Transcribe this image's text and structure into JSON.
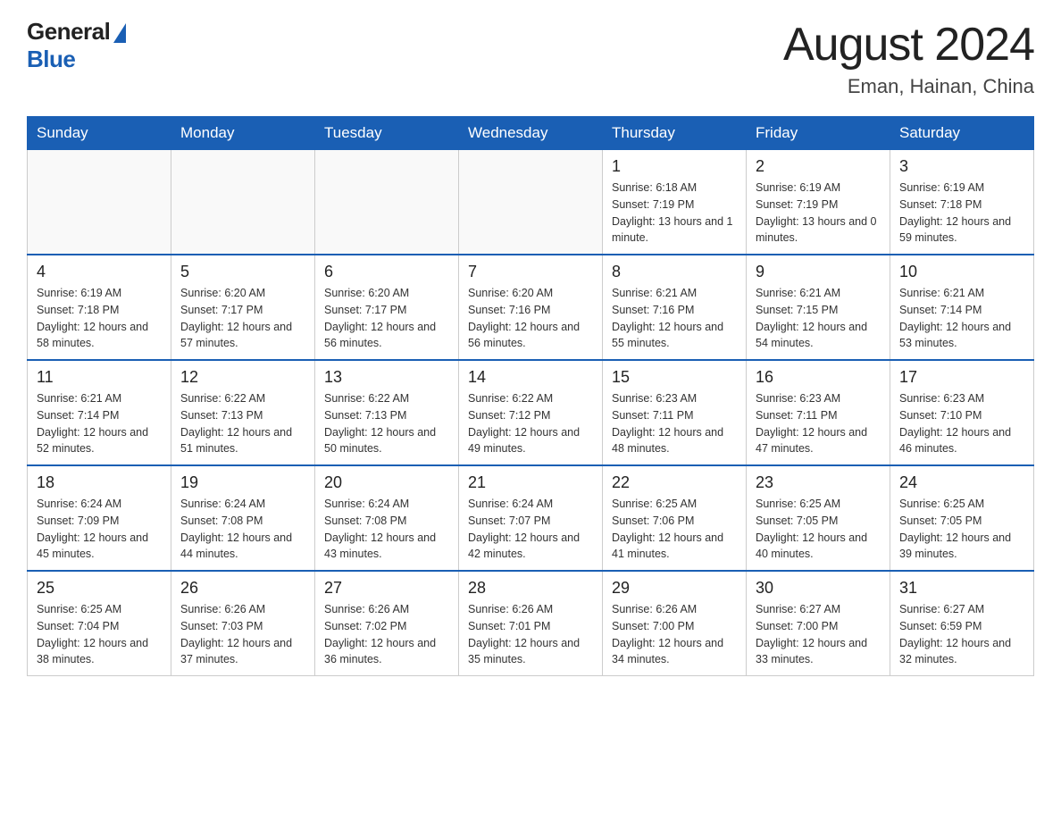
{
  "logo": {
    "general": "General",
    "blue": "Blue"
  },
  "header": {
    "month": "August 2024",
    "location": "Eman, Hainan, China"
  },
  "days_of_week": [
    "Sunday",
    "Monday",
    "Tuesday",
    "Wednesday",
    "Thursday",
    "Friday",
    "Saturday"
  ],
  "weeks": [
    [
      {
        "day": "",
        "sunrise": "",
        "sunset": "",
        "daylight": ""
      },
      {
        "day": "",
        "sunrise": "",
        "sunset": "",
        "daylight": ""
      },
      {
        "day": "",
        "sunrise": "",
        "sunset": "",
        "daylight": ""
      },
      {
        "day": "",
        "sunrise": "",
        "sunset": "",
        "daylight": ""
      },
      {
        "day": "1",
        "sunrise": "Sunrise: 6:18 AM",
        "sunset": "Sunset: 7:19 PM",
        "daylight": "Daylight: 13 hours and 1 minute."
      },
      {
        "day": "2",
        "sunrise": "Sunrise: 6:19 AM",
        "sunset": "Sunset: 7:19 PM",
        "daylight": "Daylight: 13 hours and 0 minutes."
      },
      {
        "day": "3",
        "sunrise": "Sunrise: 6:19 AM",
        "sunset": "Sunset: 7:18 PM",
        "daylight": "Daylight: 12 hours and 59 minutes."
      }
    ],
    [
      {
        "day": "4",
        "sunrise": "Sunrise: 6:19 AM",
        "sunset": "Sunset: 7:18 PM",
        "daylight": "Daylight: 12 hours and 58 minutes."
      },
      {
        "day": "5",
        "sunrise": "Sunrise: 6:20 AM",
        "sunset": "Sunset: 7:17 PM",
        "daylight": "Daylight: 12 hours and 57 minutes."
      },
      {
        "day": "6",
        "sunrise": "Sunrise: 6:20 AM",
        "sunset": "Sunset: 7:17 PM",
        "daylight": "Daylight: 12 hours and 56 minutes."
      },
      {
        "day": "7",
        "sunrise": "Sunrise: 6:20 AM",
        "sunset": "Sunset: 7:16 PM",
        "daylight": "Daylight: 12 hours and 56 minutes."
      },
      {
        "day": "8",
        "sunrise": "Sunrise: 6:21 AM",
        "sunset": "Sunset: 7:16 PM",
        "daylight": "Daylight: 12 hours and 55 minutes."
      },
      {
        "day": "9",
        "sunrise": "Sunrise: 6:21 AM",
        "sunset": "Sunset: 7:15 PM",
        "daylight": "Daylight: 12 hours and 54 minutes."
      },
      {
        "day": "10",
        "sunrise": "Sunrise: 6:21 AM",
        "sunset": "Sunset: 7:14 PM",
        "daylight": "Daylight: 12 hours and 53 minutes."
      }
    ],
    [
      {
        "day": "11",
        "sunrise": "Sunrise: 6:21 AM",
        "sunset": "Sunset: 7:14 PM",
        "daylight": "Daylight: 12 hours and 52 minutes."
      },
      {
        "day": "12",
        "sunrise": "Sunrise: 6:22 AM",
        "sunset": "Sunset: 7:13 PM",
        "daylight": "Daylight: 12 hours and 51 minutes."
      },
      {
        "day": "13",
        "sunrise": "Sunrise: 6:22 AM",
        "sunset": "Sunset: 7:13 PM",
        "daylight": "Daylight: 12 hours and 50 minutes."
      },
      {
        "day": "14",
        "sunrise": "Sunrise: 6:22 AM",
        "sunset": "Sunset: 7:12 PM",
        "daylight": "Daylight: 12 hours and 49 minutes."
      },
      {
        "day": "15",
        "sunrise": "Sunrise: 6:23 AM",
        "sunset": "Sunset: 7:11 PM",
        "daylight": "Daylight: 12 hours and 48 minutes."
      },
      {
        "day": "16",
        "sunrise": "Sunrise: 6:23 AM",
        "sunset": "Sunset: 7:11 PM",
        "daylight": "Daylight: 12 hours and 47 minutes."
      },
      {
        "day": "17",
        "sunrise": "Sunrise: 6:23 AM",
        "sunset": "Sunset: 7:10 PM",
        "daylight": "Daylight: 12 hours and 46 minutes."
      }
    ],
    [
      {
        "day": "18",
        "sunrise": "Sunrise: 6:24 AM",
        "sunset": "Sunset: 7:09 PM",
        "daylight": "Daylight: 12 hours and 45 minutes."
      },
      {
        "day": "19",
        "sunrise": "Sunrise: 6:24 AM",
        "sunset": "Sunset: 7:08 PM",
        "daylight": "Daylight: 12 hours and 44 minutes."
      },
      {
        "day": "20",
        "sunrise": "Sunrise: 6:24 AM",
        "sunset": "Sunset: 7:08 PM",
        "daylight": "Daylight: 12 hours and 43 minutes."
      },
      {
        "day": "21",
        "sunrise": "Sunrise: 6:24 AM",
        "sunset": "Sunset: 7:07 PM",
        "daylight": "Daylight: 12 hours and 42 minutes."
      },
      {
        "day": "22",
        "sunrise": "Sunrise: 6:25 AM",
        "sunset": "Sunset: 7:06 PM",
        "daylight": "Daylight: 12 hours and 41 minutes."
      },
      {
        "day": "23",
        "sunrise": "Sunrise: 6:25 AM",
        "sunset": "Sunset: 7:05 PM",
        "daylight": "Daylight: 12 hours and 40 minutes."
      },
      {
        "day": "24",
        "sunrise": "Sunrise: 6:25 AM",
        "sunset": "Sunset: 7:05 PM",
        "daylight": "Daylight: 12 hours and 39 minutes."
      }
    ],
    [
      {
        "day": "25",
        "sunrise": "Sunrise: 6:25 AM",
        "sunset": "Sunset: 7:04 PM",
        "daylight": "Daylight: 12 hours and 38 minutes."
      },
      {
        "day": "26",
        "sunrise": "Sunrise: 6:26 AM",
        "sunset": "Sunset: 7:03 PM",
        "daylight": "Daylight: 12 hours and 37 minutes."
      },
      {
        "day": "27",
        "sunrise": "Sunrise: 6:26 AM",
        "sunset": "Sunset: 7:02 PM",
        "daylight": "Daylight: 12 hours and 36 minutes."
      },
      {
        "day": "28",
        "sunrise": "Sunrise: 6:26 AM",
        "sunset": "Sunset: 7:01 PM",
        "daylight": "Daylight: 12 hours and 35 minutes."
      },
      {
        "day": "29",
        "sunrise": "Sunrise: 6:26 AM",
        "sunset": "Sunset: 7:00 PM",
        "daylight": "Daylight: 12 hours and 34 minutes."
      },
      {
        "day": "30",
        "sunrise": "Sunrise: 6:27 AM",
        "sunset": "Sunset: 7:00 PM",
        "daylight": "Daylight: 12 hours and 33 minutes."
      },
      {
        "day": "31",
        "sunrise": "Sunrise: 6:27 AM",
        "sunset": "Sunset: 6:59 PM",
        "daylight": "Daylight: 12 hours and 32 minutes."
      }
    ]
  ]
}
